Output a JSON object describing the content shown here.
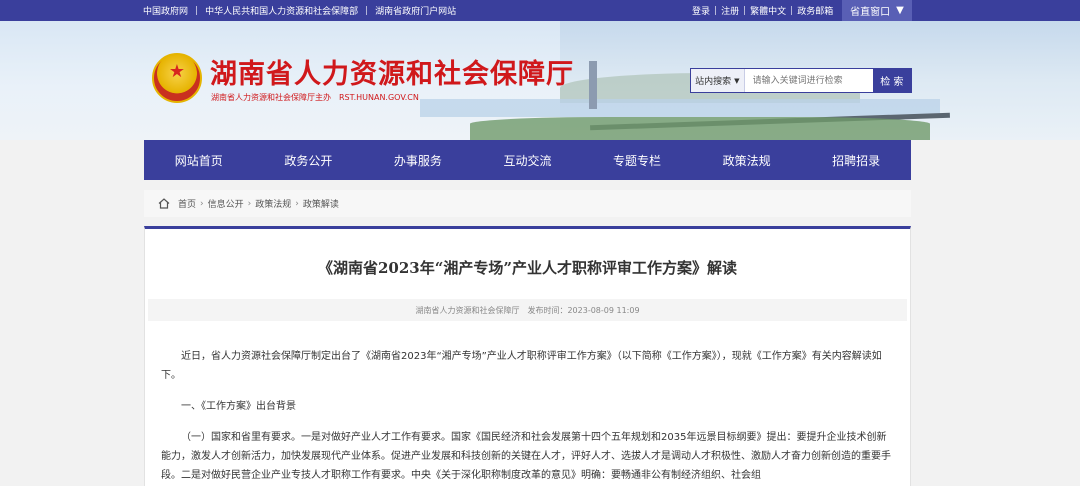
{
  "topbar": {
    "left_links": [
      "中国政府网",
      "中华人民共和国人力资源和社会保障部",
      "湖南省政府门户网站"
    ],
    "right_links": [
      "登录",
      "注册",
      "繁體中文",
      "政务邮箱"
    ],
    "province_window": "省直窗口"
  },
  "header": {
    "title": "湖南省人力资源和社会保障厅",
    "subtitle": "湖南省人力资源和社会保障厅主办　RST.HUNAN.GOV.CN"
  },
  "search": {
    "scope": "站内搜索",
    "placeholder": "请输入关键词进行检索",
    "button": "检 索"
  },
  "nav": {
    "items": [
      "网站首页",
      "政务公开",
      "办事服务",
      "互动交流",
      "专题专栏",
      "政策法规",
      "招聘招录"
    ]
  },
  "breadcrumb": [
    "首页",
    "信息公开",
    "政策法规",
    "政策解读"
  ],
  "article": {
    "title": "《湖南省2023年“湘产专场”产业人才职称评审工作方案》解读",
    "source": "湖南省人力资源和社会保障厅",
    "date_label": "发布时间：",
    "date": "2023-08-09 11:09",
    "paragraphs": [
      "近日，省人力资源社会保障厅制定出台了《湖南省2023年“湘产专场”产业人才职称评审工作方案》（以下简称《工作方案》），现就《工作方案》有关内容解读如下。",
      "一、《工作方案》出台背景",
      "（一）国家和省里有要求。一是对做好产业人才工作有要求。国家《国民经济和社会发展第十四个五年规划和2035年远景目标纲要》提出：要提升企业技术创新能力，激发人才创新活力，加快发展现代产业体系。促进产业发展和科技创新的关键在人才，评好人才、选拔人才是调动人才积极性、激励人才奋力创新创造的重要手段。二是对做好民营企业产业专技人才职称工作有要求。中央《关于深化职称制度改革的意见》明确：要畅通非公有制经济组织、社会组"
    ]
  }
}
